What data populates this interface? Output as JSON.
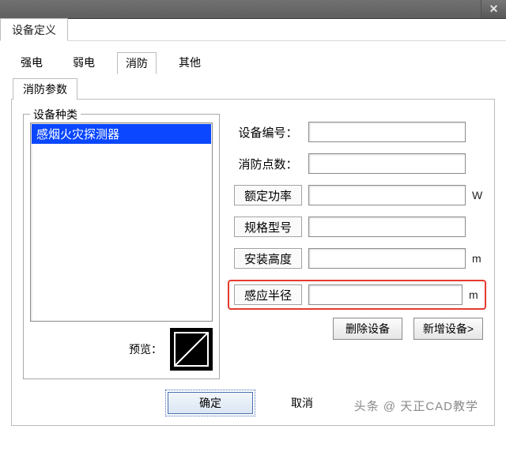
{
  "titlebar": {
    "close_glyph": "✕"
  },
  "main_tab": {
    "label": "设备定义"
  },
  "category_tabs": {
    "items": [
      {
        "label": "强电"
      },
      {
        "label": "弱电"
      },
      {
        "label": "消防",
        "active": true
      },
      {
        "label": "其他"
      }
    ]
  },
  "sub_tab": {
    "label": "消防参数"
  },
  "device_type_group": {
    "title": "设备种类",
    "items": [
      {
        "label": "感烟火灾探测器",
        "selected": true
      }
    ],
    "preview_label": "预览："
  },
  "form": {
    "rows": [
      {
        "key": "device_no",
        "label": "设备编号：",
        "boxed": false,
        "unit": "",
        "value": ""
      },
      {
        "key": "fire_points",
        "label": "消防点数：",
        "boxed": false,
        "unit": "",
        "value": ""
      },
      {
        "key": "rated_power",
        "label": "额定功率",
        "boxed": true,
        "unit": "W",
        "value": ""
      },
      {
        "key": "spec_model",
        "label": "规格型号",
        "boxed": true,
        "unit": "",
        "value": ""
      },
      {
        "key": "install_h",
        "label": "安装高度",
        "boxed": true,
        "unit": "m",
        "value": ""
      },
      {
        "key": "sense_r",
        "label": "感应半径",
        "boxed": true,
        "unit": "m",
        "value": "",
        "highlight": true
      }
    ]
  },
  "buttons": {
    "delete": "删除设备",
    "add": "新增设备>",
    "ok": "确定",
    "cancel": "取消"
  },
  "watermark": "头条 @ 天正CAD教学"
}
